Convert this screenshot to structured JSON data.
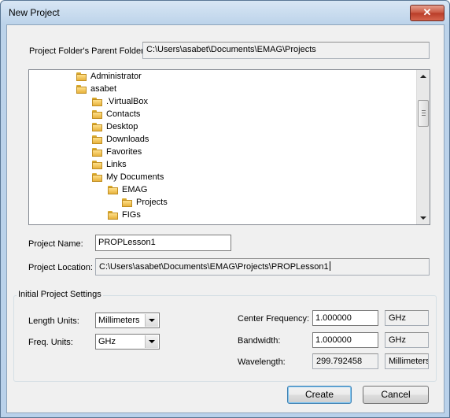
{
  "window": {
    "title": "New Project",
    "close_glyph": "✕"
  },
  "parent_folder": {
    "label": "Project Folder's Parent Folder:",
    "value": "C:\\Users\\asabet\\Documents\\EMAG\\Projects"
  },
  "tree": {
    "items": [
      {
        "label": "Administrator",
        "icon": "folder-icon"
      },
      {
        "label": "asabet",
        "icon": "folder-icon"
      },
      {
        "label": ".VirtualBox",
        "icon": "folder-icon"
      },
      {
        "label": "Contacts",
        "icon": "contacts-folder-icon"
      },
      {
        "label": "Desktop",
        "icon": "desktop-folder-icon"
      },
      {
        "label": "Downloads",
        "icon": "downloads-folder-icon"
      },
      {
        "label": "Favorites",
        "icon": "favorites-folder-icon"
      },
      {
        "label": "Links",
        "icon": "links-folder-icon"
      },
      {
        "label": "My Documents",
        "icon": "documents-folder-icon"
      },
      {
        "label": "EMAG",
        "icon": "folder-icon"
      },
      {
        "label": "Projects",
        "icon": "folder-icon"
      },
      {
        "label": "FIGs",
        "icon": "folder-icon"
      }
    ]
  },
  "project_name": {
    "label": "Project Name:",
    "value": "PROPLesson1"
  },
  "project_location": {
    "label": "Project Location:",
    "value": "C:\\Users\\asabet\\Documents\\EMAG\\Projects\\PROPLesson1"
  },
  "settings": {
    "legend": "Initial Project Settings",
    "length_units": {
      "label": "Length Units:",
      "selected": "Millimeters"
    },
    "freq_units": {
      "label": "Freq. Units:",
      "selected": "GHz"
    },
    "center_frequency": {
      "label": "Center Frequency:",
      "value": "1.000000",
      "unit": "GHz"
    },
    "bandwidth": {
      "label": "Bandwidth:",
      "value": "1.000000",
      "unit": "GHz"
    },
    "wavelength": {
      "label": "Wavelength:",
      "value": "299.792458",
      "unit": "Millimeters"
    }
  },
  "buttons": {
    "create": "Create",
    "cancel": "Cancel"
  },
  "colors": {
    "close_button": "#c8553f",
    "folder": "#e7b23c",
    "default_button_border": "#3c7fb1"
  }
}
